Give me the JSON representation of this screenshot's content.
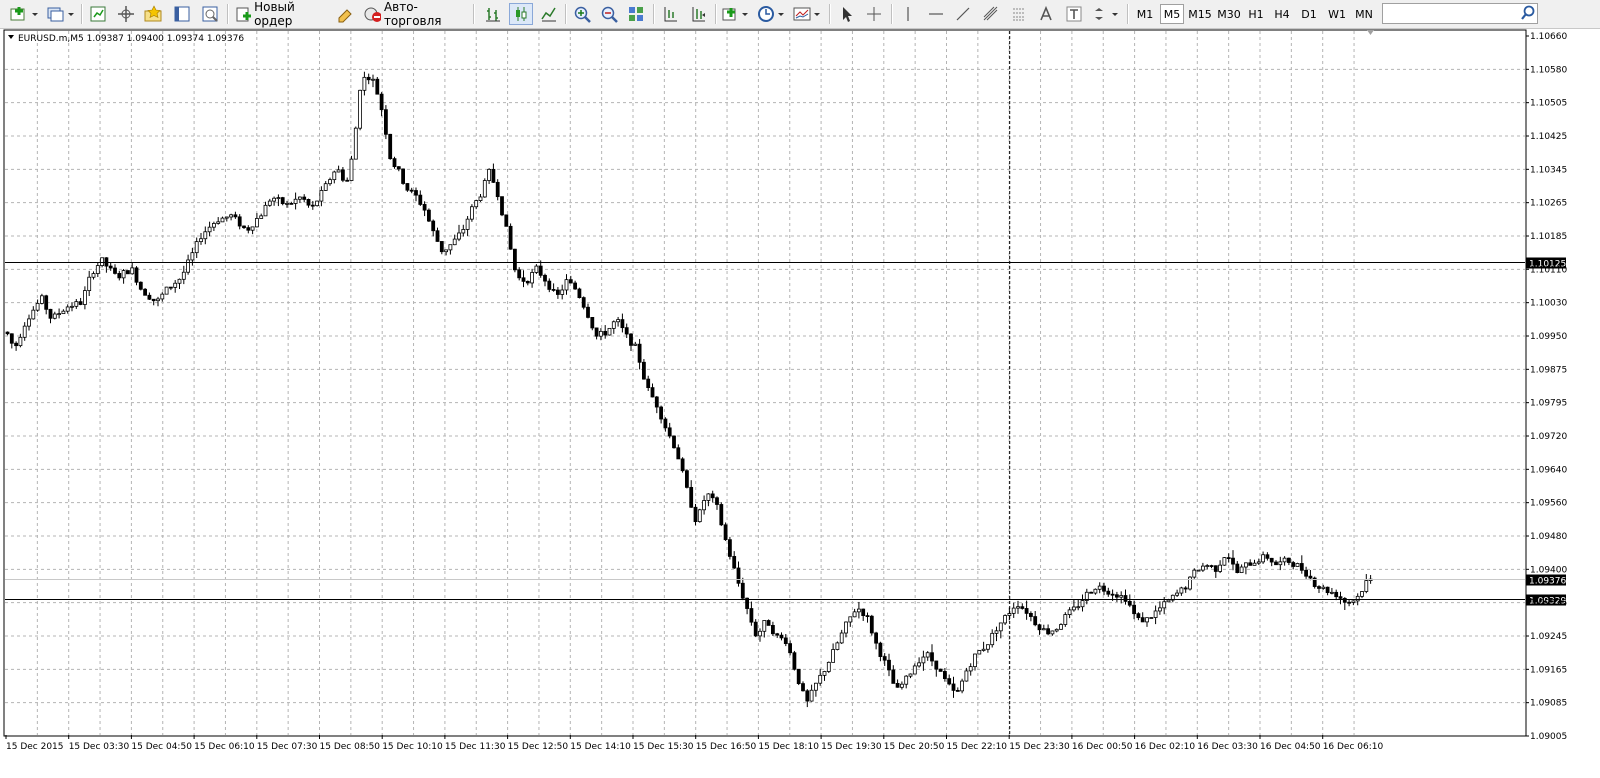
{
  "toolbar": {
    "new_order_label": "Новый ордер",
    "auto_trading_label": "Авто-торговля",
    "timeframes": [
      "M1",
      "M5",
      "M15",
      "M30",
      "H1",
      "H4",
      "D1",
      "W1",
      "MN"
    ],
    "active_timeframe": "M5",
    "search_value": ""
  },
  "chart_header": {
    "symbol_line": "EURUSD.m,M5  1.09387 1.09400 1.09374 1.09376"
  },
  "colors": {
    "grid": "#b4b4b4",
    "candle": "#000000",
    "background": "#ffffff",
    "price_label_bg": "#000000",
    "price_label_fg": "#ffffff"
  },
  "icons": {
    "new_chart": "new-chart-icon",
    "profiles": "profiles-icon",
    "market_watch": "market-watch-icon",
    "data_window": "crosshair-move-icon",
    "navigator": "navigator-star-icon",
    "terminal": "terminal-icon",
    "strategy_tester": "strategy-tester-icon",
    "new_order": "new-order-icon",
    "metaeditor": "metaeditor-pencil-icon",
    "auto_trading": "auto-trading-icon",
    "search": "search-icon"
  },
  "chart_data": {
    "type": "candlestick",
    "symbol": "EURUSD.m",
    "timeframe": "M5",
    "ohlc_header": {
      "open": 1.09387,
      "high": 1.094,
      "low": 1.09374,
      "close": 1.09376
    },
    "y_ticks": [
      "1.10660",
      "1.10580",
      "1.10505",
      "1.10425",
      "1.10345",
      "1.10265",
      "1.10185",
      "1.10110",
      "1.10030",
      "1.09950",
      "1.09875",
      "1.09795",
      "1.09720",
      "1.09640",
      "1.09560",
      "1.09480",
      "1.09400",
      "1.09325",
      "1.09245",
      "1.09165",
      "1.09085",
      "1.09005"
    ],
    "ylim": [
      1.09005,
      1.1066
    ],
    "x_ticks": [
      "15 Dec 2015",
      "15 Dec 03:30",
      "15 Dec 04:50",
      "15 Dec 06:10",
      "15 Dec 07:30",
      "15 Dec 08:50",
      "15 Dec 10:10",
      "15 Dec 11:30",
      "15 Dec 12:50",
      "15 Dec 14:10",
      "15 Dec 15:30",
      "15 Dec 16:50",
      "15 Dec 18:10",
      "15 Dec 19:30",
      "15 Dec 20:50",
      "15 Dec 22:10",
      "15 Dec 23:30",
      "16 Dec 00:50",
      "16 Dec 02:10",
      "16 Dec 03:30",
      "16 Dec 04:50",
      "16 Dec 06:10"
    ],
    "horizontal_lines": [
      {
        "price": 1.10125,
        "label": "1.10125"
      },
      {
        "price": 1.09329,
        "label": "1.09329"
      }
    ],
    "bid_line": {
      "price": 1.09376,
      "label": "1.09376"
    },
    "vertical_line": {
      "time": "15 Dec 23:30"
    },
    "price_path": [
      [
        0,
        1.0996
      ],
      [
        8,
        1.0992
      ],
      [
        20,
        1.0999
      ],
      [
        35,
        1.1004
      ],
      [
        45,
        1.0999
      ],
      [
        60,
        1.1002
      ],
      [
        75,
        1.1003
      ],
      [
        85,
        1.101
      ],
      [
        95,
        1.1013
      ],
      [
        110,
        1.1009
      ],
      [
        125,
        1.1011
      ],
      [
        135,
        1.1006
      ],
      [
        150,
        1.1003
      ],
      [
        160,
        1.1006
      ],
      [
        175,
        1.1009
      ],
      [
        185,
        1.1014
      ],
      [
        195,
        1.1019
      ],
      [
        210,
        1.10225
      ],
      [
        225,
        1.10235
      ],
      [
        240,
        1.102
      ],
      [
        255,
        1.1024
      ],
      [
        265,
        1.1028
      ],
      [
        280,
        1.1026
      ],
      [
        295,
        1.1028
      ],
      [
        305,
        1.1025
      ],
      [
        318,
        1.103
      ],
      [
        330,
        1.1035
      ],
      [
        340,
        1.1031
      ],
      [
        348,
        1.104
      ],
      [
        352,
        1.1053
      ],
      [
        360,
        1.1057
      ],
      [
        368,
        1.1055
      ],
      [
        376,
        1.1048
      ],
      [
        384,
        1.1037
      ],
      [
        392,
        1.1034
      ],
      [
        400,
        1.103
      ],
      [
        410,
        1.1028
      ],
      [
        418,
        1.1025
      ],
      [
        426,
        1.102
      ],
      [
        436,
        1.1015
      ],
      [
        446,
        1.1017
      ],
      [
        456,
        1.102
      ],
      [
        465,
        1.1025
      ],
      [
        475,
        1.1029
      ],
      [
        483,
        1.1034
      ],
      [
        491,
        1.1029
      ],
      [
        500,
        1.102
      ],
      [
        510,
        1.1009
      ],
      [
        520,
        1.1008
      ],
      [
        530,
        1.1011
      ],
      [
        540,
        1.1008
      ],
      [
        550,
        1.1004
      ],
      [
        560,
        1.1008
      ],
      [
        570,
        1.1006
      ],
      [
        580,
        1.1001
      ],
      [
        590,
        1.0995
      ],
      [
        600,
        1.0996
      ],
      [
        610,
        1.0999
      ],
      [
        620,
        1.0995
      ],
      [
        630,
        1.0992
      ],
      [
        640,
        1.0983
      ],
      [
        650,
        1.0979
      ],
      [
        660,
        1.0973
      ],
      [
        670,
        1.0968
      ],
      [
        680,
        1.0959
      ],
      [
        690,
        1.0951
      ],
      [
        700,
        1.0958
      ],
      [
        710,
        1.0955
      ],
      [
        720,
        1.0946
      ],
      [
        730,
        1.0938
      ],
      [
        740,
        1.0931
      ],
      [
        750,
        1.0924
      ],
      [
        760,
        1.0928
      ],
      [
        770,
        1.0924
      ],
      [
        780,
        1.0923
      ],
      [
        790,
        1.0915
      ],
      [
        800,
        1.0908
      ],
      [
        810,
        1.0913
      ],
      [
        820,
        1.0917
      ],
      [
        830,
        1.0922
      ],
      [
        840,
        1.0927
      ],
      [
        850,
        1.0931
      ],
      [
        860,
        1.0929
      ],
      [
        870,
        1.0922
      ],
      [
        880,
        1.0917
      ],
      [
        890,
        1.0911
      ],
      [
        900,
        1.0914
      ],
      [
        910,
        1.0918
      ],
      [
        920,
        1.092
      ],
      [
        930,
        1.0917
      ],
      [
        940,
        1.0913
      ],
      [
        950,
        1.091
      ],
      [
        960,
        1.0916
      ],
      [
        970,
        1.092
      ],
      [
        980,
        1.0922
      ],
      [
        990,
        1.0926
      ],
      [
        1000,
        1.0929
      ],
      [
        1010,
        1.0932
      ],
      [
        1020,
        1.093
      ],
      [
        1030,
        1.0927
      ],
      [
        1040,
        1.0925
      ],
      [
        1050,
        1.0926
      ],
      [
        1060,
        1.0929
      ],
      [
        1070,
        1.0931
      ],
      [
        1080,
        1.0934
      ],
      [
        1090,
        1.0936
      ],
      [
        1100,
        1.0935
      ],
      [
        1110,
        1.0934
      ],
      [
        1120,
        1.0933
      ],
      [
        1130,
        1.0928
      ],
      [
        1140,
        1.0928
      ],
      [
        1150,
        1.093
      ],
      [
        1160,
        1.0932
      ],
      [
        1170,
        1.0934
      ],
      [
        1180,
        1.0936
      ],
      [
        1190,
        1.094
      ],
      [
        1200,
        1.0941
      ],
      [
        1210,
        1.094
      ],
      [
        1220,
        1.0944
      ],
      [
        1230,
        1.0939
      ],
      [
        1240,
        1.0941
      ],
      [
        1250,
        1.0942
      ],
      [
        1260,
        1.0943
      ],
      [
        1270,
        1.0941
      ],
      [
        1280,
        1.0942
      ],
      [
        1290,
        1.0941
      ],
      [
        1300,
        1.0939
      ],
      [
        1310,
        1.0936
      ],
      [
        1320,
        1.0935
      ],
      [
        1330,
        1.0934
      ],
      [
        1340,
        1.0932
      ],
      [
        1350,
        1.0933
      ],
      [
        1360,
        1.0937
      ],
      [
        1367,
        1.09376
      ]
    ]
  }
}
